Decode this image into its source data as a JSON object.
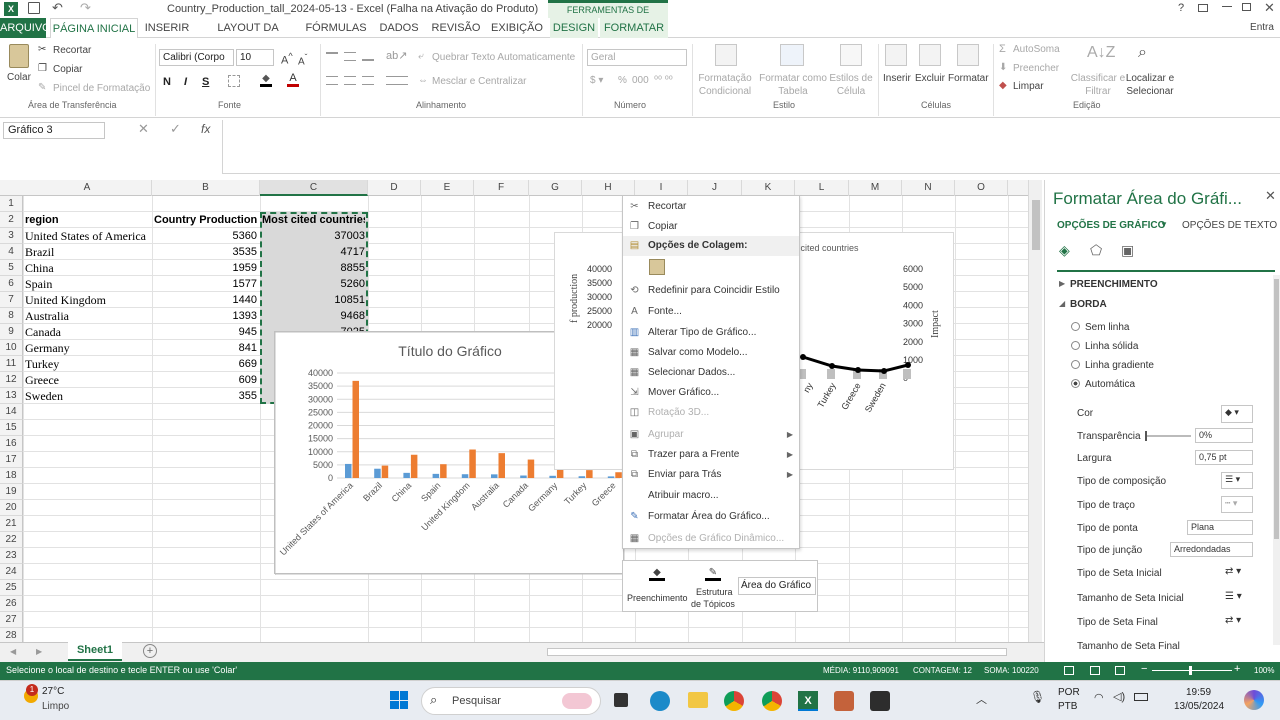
{
  "window": {
    "title": "Country_Production_tall_2024-05-13 - Excel (Falha na Ativação do Produto)",
    "context_tool": "FERRAMENTAS DE GRÁFICO",
    "help": "?",
    "signin": "Entra"
  },
  "tabs": [
    "ARQUIVO",
    "PÁGINA INICIAL",
    "INSERIR",
    "LAYOUT DA PÁGINA",
    "FÓRMULAS",
    "DADOS",
    "REVISÃO",
    "EXIBIÇÃO",
    "DESIGN",
    "FORMATAR"
  ],
  "ribbon": {
    "paste": "Colar",
    "cut": "Recortar",
    "copy": "Copiar",
    "format_painter": "Pincel de Formatação",
    "clipboard_group": "Área de Transferência",
    "font_name": "Calibri (Corpo",
    "font_size": "10",
    "bold": "N",
    "italic": "I",
    "underline": "S",
    "font_group": "Fonte",
    "wrap_text": "Quebrar Texto Automaticamente",
    "merge_center": "Mesclar e Centralizar",
    "alignment_group": "Alinhamento",
    "number_format": "Geral",
    "percent": "%",
    "thousands": "000",
    "number_group": "Número",
    "cond_format": "Formatação Condicional",
    "format_table": "Formatar como Tabela",
    "cell_styles": "Estilos de Célula",
    "styles_group": "Estilo",
    "insert": "Inserir",
    "delete": "Excluir",
    "format": "Formatar",
    "cells_group": "Células",
    "autosum": "AutoSoma",
    "fill": "Preencher",
    "clear": "Limpar",
    "sort_filter": "Classificar e Filtrar",
    "find_select": "Localizar e Selecionar",
    "editing_group": "Edição"
  },
  "formula_bar": {
    "name_box": "Gráfico 3",
    "fx": "fx"
  },
  "columns": [
    "A",
    "B",
    "C",
    "D",
    "E",
    "F",
    "G",
    "H",
    "I",
    "J",
    "K",
    "L",
    "M",
    "N",
    "O"
  ],
  "rows": [
    "1",
    "2",
    "3",
    "4",
    "5",
    "6",
    "7",
    "8",
    "9",
    "10",
    "11",
    "12",
    "13",
    "14",
    "15",
    "16",
    "17",
    "18",
    "19",
    "20",
    "21",
    "22",
    "23",
    "24",
    "25",
    "26",
    "27",
    "28"
  ],
  "table": {
    "headers": [
      "region",
      "Country Production",
      "Most cited countries"
    ],
    "rows": [
      [
        "United States of America",
        "5360",
        "37003"
      ],
      [
        "Brazil",
        "3535",
        "4717"
      ],
      [
        "China",
        "1959",
        "8855"
      ],
      [
        "Spain",
        "1577",
        "5260"
      ],
      [
        "United Kingdom",
        "1440",
        "10851"
      ],
      [
        "Australia",
        "1393",
        "9468"
      ],
      [
        "Canada",
        "945",
        "7025"
      ],
      [
        "Germany",
        "841",
        ""
      ],
      [
        "Turkey",
        "669",
        ""
      ],
      [
        "Greece",
        "609",
        ""
      ],
      [
        "Sweden",
        "355",
        ""
      ]
    ]
  },
  "chart_data": [
    {
      "type": "bar",
      "title": "Título do Gráfico",
      "categories": [
        "United States of America",
        "Brazil",
        "China",
        "Spain",
        "United Kingdom",
        "Australia",
        "Canada",
        "Germany",
        "Turkey",
        "Greece"
      ],
      "series": [
        {
          "name": "Country Production",
          "values": [
            5360,
            3535,
            1959,
            1577,
            1440,
            1393,
            945,
            841,
            669,
            609
          ],
          "color": "#5b9bd5"
        },
        {
          "name": "Most cited countries",
          "values": [
            37003,
            4717,
            8855,
            5260,
            10851,
            9468,
            7025,
            6500,
            3000,
            2200
          ],
          "color": "#ed7d31"
        }
      ],
      "yticks": [
        "40000",
        "35000",
        "30000",
        "25000",
        "20000",
        "15000",
        "10000",
        "5000",
        "0"
      ],
      "ylim": [
        0,
        40000
      ],
      "grid": true
    },
    {
      "type": "line",
      "title_fragment": "st cited countries",
      "ylabel_left_fragment": "f production",
      "ylabel_right": "Impact",
      "yticks_left": [
        "40000",
        "35000",
        "30000",
        "25000",
        "20000"
      ],
      "yticks_right": [
        "6000",
        "5000",
        "4000",
        "3000",
        "2000",
        "1000",
        "0"
      ],
      "categories_visible": [
        "ny",
        "Turkey",
        "Greece",
        "Sweden"
      ]
    }
  ],
  "context_menu": {
    "items": [
      {
        "label": "Recortar",
        "icon": "scissors-icon",
        "disabled": false,
        "submenu": false
      },
      {
        "label": "Copiar",
        "icon": "copy-icon",
        "disabled": false,
        "submenu": false
      },
      {
        "label": "Opções de Colagem:",
        "icon": "clipboard-icon",
        "disabled": false,
        "submenu": false,
        "header": true
      },
      {
        "label": "",
        "icon": "paste-icon",
        "disabled": false,
        "submenu": false,
        "paste_row": true
      },
      {
        "label": "Redefinir para Coincidir Estilo",
        "icon": "reset-style-icon",
        "disabled": false,
        "submenu": false
      },
      {
        "label": "Fonte...",
        "icon": "font-icon",
        "disabled": false,
        "submenu": false
      },
      {
        "label": "Alterar Tipo de Gráfico...",
        "icon": "chart-type-icon",
        "disabled": false,
        "submenu": false
      },
      {
        "label": "Salvar como Modelo...",
        "icon": "template-icon",
        "disabled": false,
        "submenu": false
      },
      {
        "label": "Selecionar Dados...",
        "icon": "select-data-icon",
        "disabled": false,
        "submenu": false
      },
      {
        "label": "Mover Gráfico...",
        "icon": "move-chart-icon",
        "disabled": false,
        "submenu": false
      },
      {
        "label": "Rotação 3D...",
        "icon": "rotate-3d-icon",
        "disabled": true,
        "submenu": false
      },
      {
        "label": "Agrupar",
        "icon": "group-icon",
        "disabled": true,
        "submenu": true
      },
      {
        "label": "Trazer para a Frente",
        "icon": "bring-front-icon",
        "disabled": false,
        "submenu": true
      },
      {
        "label": "Enviar para Trás",
        "icon": "send-back-icon",
        "disabled": false,
        "submenu": true
      },
      {
        "label": "Atribuir macro...",
        "icon": "",
        "disabled": false,
        "submenu": false
      },
      {
        "label": "Formatar Área do Gráfico...",
        "icon": "format-area-icon",
        "disabled": false,
        "submenu": false
      },
      {
        "label": "Opções de Gráfico Dinâmico...",
        "icon": "pivot-chart-icon",
        "disabled": true,
        "submenu": false
      }
    ]
  },
  "mini_toolbar": {
    "fill": "Preenchimento",
    "outline_1": "Estrutura",
    "outline_2": "de Tópicos",
    "element": "Área do Gráfico"
  },
  "format_pane": {
    "title": "Formatar Área do Gráfi...",
    "tab_chart": "OPÇÕES DE GRÁFICO",
    "tab_text": "OPÇÕES DE TEXTO",
    "fill_section": "PREENCHIMENTO",
    "border_section": "BORDA",
    "radios": [
      "Sem linha",
      "Linha sólida",
      "Linha gradiente",
      "Automática"
    ],
    "selected_radio": 3,
    "color": "Cor",
    "transparency": "Transparência",
    "transparency_value": "0%",
    "width": "Largura",
    "width_value": "0,75 pt",
    "compound": "Tipo de composição",
    "dash": "Tipo de traço",
    "cap": "Tipo de ponta",
    "cap_value": "Plana",
    "join": "Tipo de junção",
    "join_value": "Arredondadas",
    "begin_arrow": "Tipo de Seta Inicial",
    "begin_size": "Tamanho de Seta Inicial",
    "end_arrow": "Tipo de Seta Final",
    "end_size": "Tamanho de Seta Final"
  },
  "sheet_tabs": {
    "active": "Sheet1"
  },
  "status": {
    "message": "Selecione o local de destino e tecle ENTER ou use 'Colar'",
    "average": "MÉDIA: 9110,909091",
    "count": "CONTAGEM: 12",
    "sum": "SOMA: 100220",
    "zoom": "100%"
  },
  "taskbar": {
    "temp": "27°C",
    "weather": "Limpo",
    "search": "Pesquisar",
    "lang1": "POR",
    "lang2": "PTB",
    "time": "19:59",
    "date": "13/05/2024",
    "badge": "1"
  },
  "colors": {
    "excel_green": "#217346",
    "series1": "#5b9bd5",
    "series2": "#ed7d31",
    "accent": "#217346"
  }
}
